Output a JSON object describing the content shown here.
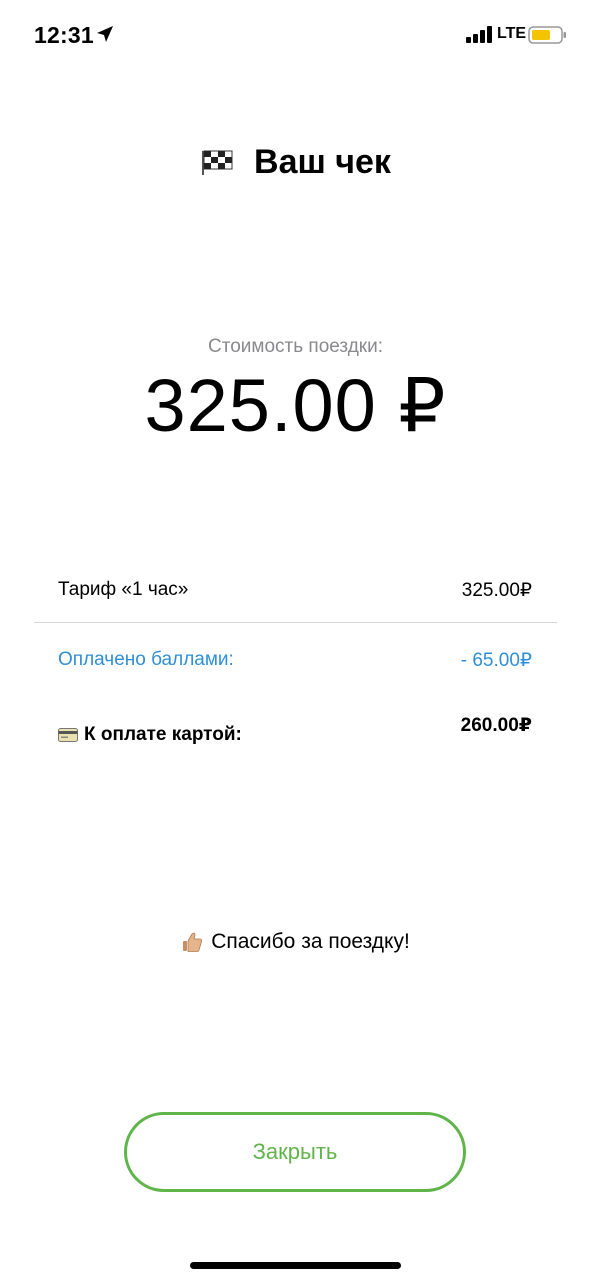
{
  "status_bar": {
    "time": "12:31",
    "network": "LTE",
    "battery_color": "#f5c400"
  },
  "header": {
    "icon": "checkered-flag-icon",
    "title": "Ваш чек"
  },
  "price": {
    "label": "Стоимость поездки:",
    "amount": "325.00 ₽"
  },
  "rows": {
    "tariff": {
      "label": "Тариф «1 час»",
      "value": "325.00₽"
    },
    "points": {
      "label": "Оплачено баллами:",
      "value": "- 65.00₽",
      "color": "#2f8fd6"
    },
    "card": {
      "icon": "credit-card-icon",
      "label": "К оплате картой:",
      "value": "260.00₽"
    }
  },
  "thanks": {
    "icon": "thumbs-up-icon",
    "text": "Спасибо за поездку!"
  },
  "close_button": {
    "label": "Закрыть",
    "color": "#5fb54a"
  }
}
